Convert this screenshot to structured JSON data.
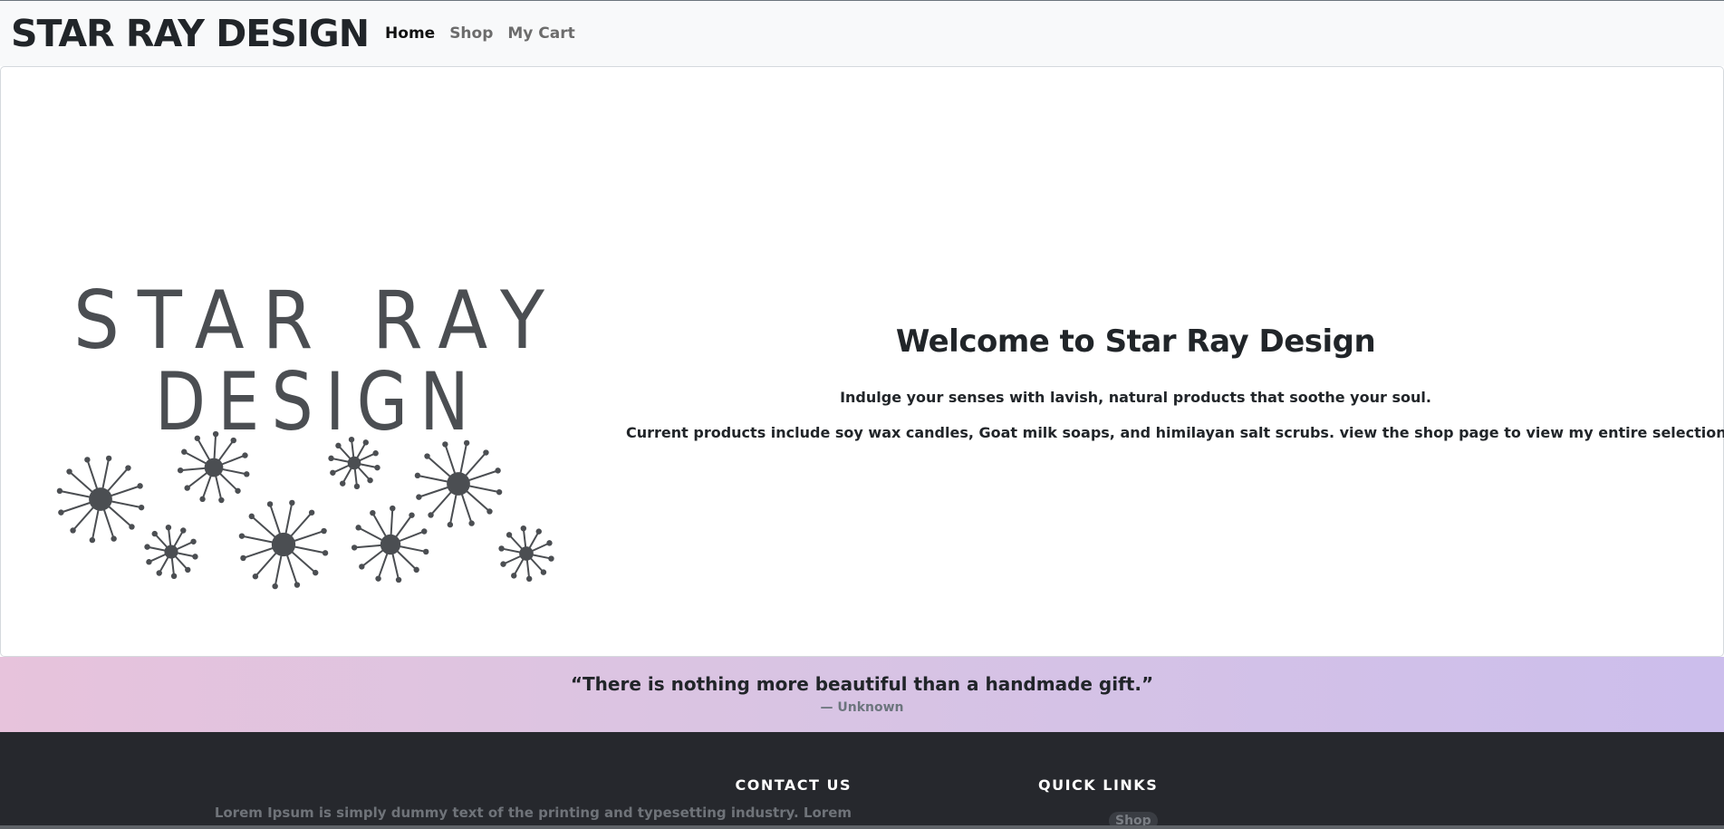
{
  "navbar": {
    "brand": "STAR RAY DESIGN",
    "links": [
      "Home",
      "Shop",
      "My Cart"
    ],
    "active": "Home"
  },
  "hero": {
    "logo_text": [
      "STAR RAY",
      "DESIGN"
    ],
    "title": "Welcome to Star Ray Design",
    "paragraph1": "Indulge your senses with lavish, natural products that soothe your soul.",
    "paragraph2": "Current products include soy wax candles, Goat milk soaps, and himilayan salt scrubs. view the shop page to view my entire selection."
  },
  "quote": {
    "text": "“There is nothing more beautiful than a handmade gift.”",
    "author": "— Unknown"
  },
  "footer": {
    "contact_title": "CONTACT US",
    "contact_text": "Lorem Ipsum is simply dummy text of the printing and typesetting industry. Lorem",
    "links_title": "QUICK LINKS",
    "links": [
      "Shop"
    ]
  },
  "colors": {
    "navbar_bg": "#f8f9fa",
    "text_dark": "#212529",
    "logo_gray": "#4b4e52",
    "footer_bg": "#26282d",
    "gradient_start": "#e7c3dc",
    "gradient_end": "#ccbeec"
  },
  "icons": {
    "logo_decoration": "starburst-icon"
  }
}
